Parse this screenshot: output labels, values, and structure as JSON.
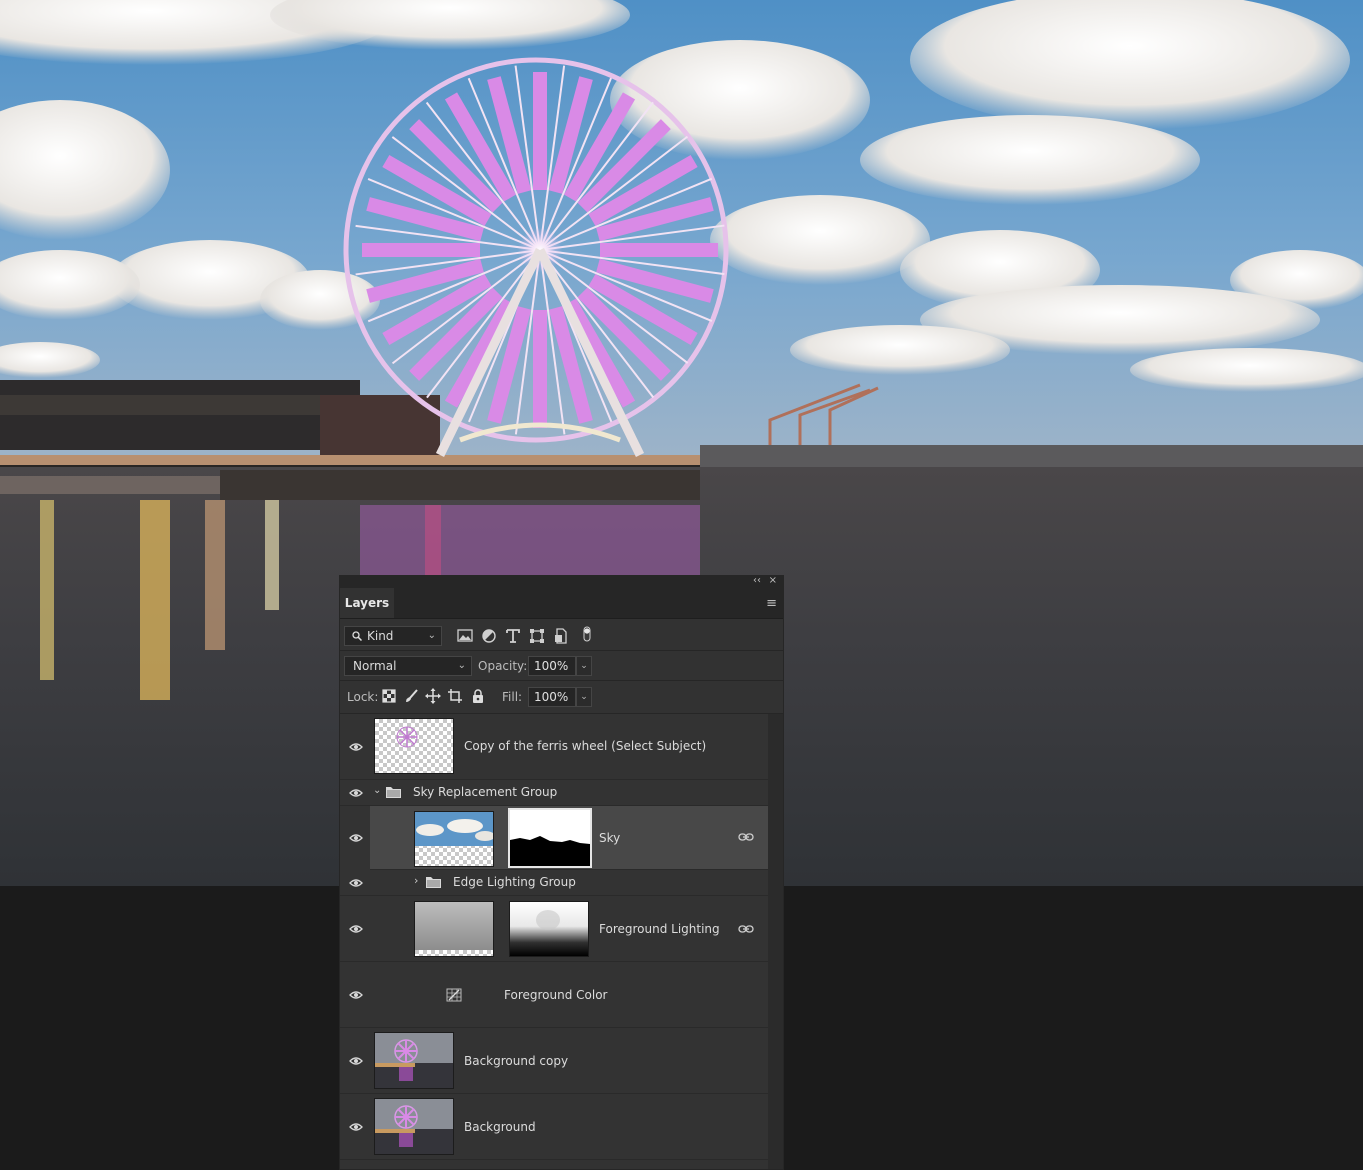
{
  "panel": {
    "tab_label": "Layers",
    "collapse_glyph": "‹‹",
    "close_glyph": "×",
    "menu_glyph": "≡"
  },
  "filter": {
    "kind_label": "Kind",
    "icons": [
      "pixel-filter-icon",
      "adjustment-filter-icon",
      "type-filter-icon",
      "shape-filter-icon",
      "smart-object-filter-icon",
      "filter-toggle-icon"
    ]
  },
  "blend": {
    "mode": "Normal",
    "opacity_label": "Opacity:",
    "opacity_value": "100%"
  },
  "lock": {
    "label": "Lock:",
    "icons": [
      "lock-transparent-pixels-icon",
      "lock-image-pixels-icon",
      "lock-position-icon",
      "lock-artboard-icon",
      "lock-all-icon"
    ],
    "fill_label": "Fill:",
    "fill_value": "100%"
  },
  "layers": [
    {
      "name": "Copy of the ferris wheel (Select Subject)"
    },
    {
      "name": "Sky Replacement Group"
    },
    {
      "name": "Sky"
    },
    {
      "name": "Edge Lighting Group"
    },
    {
      "name": "Foreground Lighting"
    },
    {
      "name": "Foreground Color"
    },
    {
      "name": "Background copy"
    },
    {
      "name": "Background"
    }
  ],
  "colors": {
    "panel_bg": "#323232",
    "selected_row": "#484848",
    "wheel_accent": "#d98ae6",
    "sky_top": "#4e8fc4",
    "water": "#3f3f41"
  }
}
